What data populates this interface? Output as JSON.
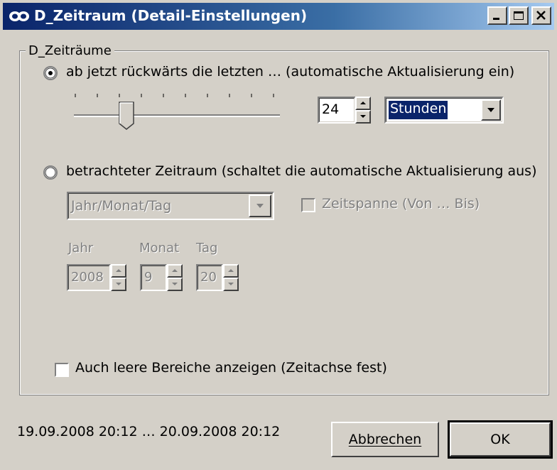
{
  "window": {
    "title": "D_Zeitraum (Detail-Einstellungen)"
  },
  "group": {
    "legend": "D_Zeiträume"
  },
  "option_relative": {
    "label": "ab jetzt rückwärts die letzten … (automatische Aktualisierung ein)",
    "selected": true,
    "slider_level": 0.25,
    "amount_value": "24",
    "unit_value": "Stunden"
  },
  "option_absolute": {
    "label": "betrachteter Zeitraum (schaltet die automatische Aktualisierung aus)",
    "selected": false,
    "mode_value": "Jahr/Monat/Tag",
    "timespan_label": "Zeitspanne (Von … Bis)",
    "year_label": "Jahr",
    "month_label": "Monat",
    "day_label": "Tag",
    "year_value": "2008",
    "month_value": "9",
    "day_value": "20"
  },
  "empty_ranges": {
    "label": "Auch leere Bereiche anzeigen (Zeitachse fest)"
  },
  "footer": {
    "range_text": "19.09.2008 20:12 … 20.09.2008 20:12",
    "cancel_label": "Abbrechen",
    "ok_label": "OK"
  },
  "colors": {
    "titlebar": "#0a246a",
    "selection": "#0a246a",
    "face": "#d4d0c8"
  }
}
